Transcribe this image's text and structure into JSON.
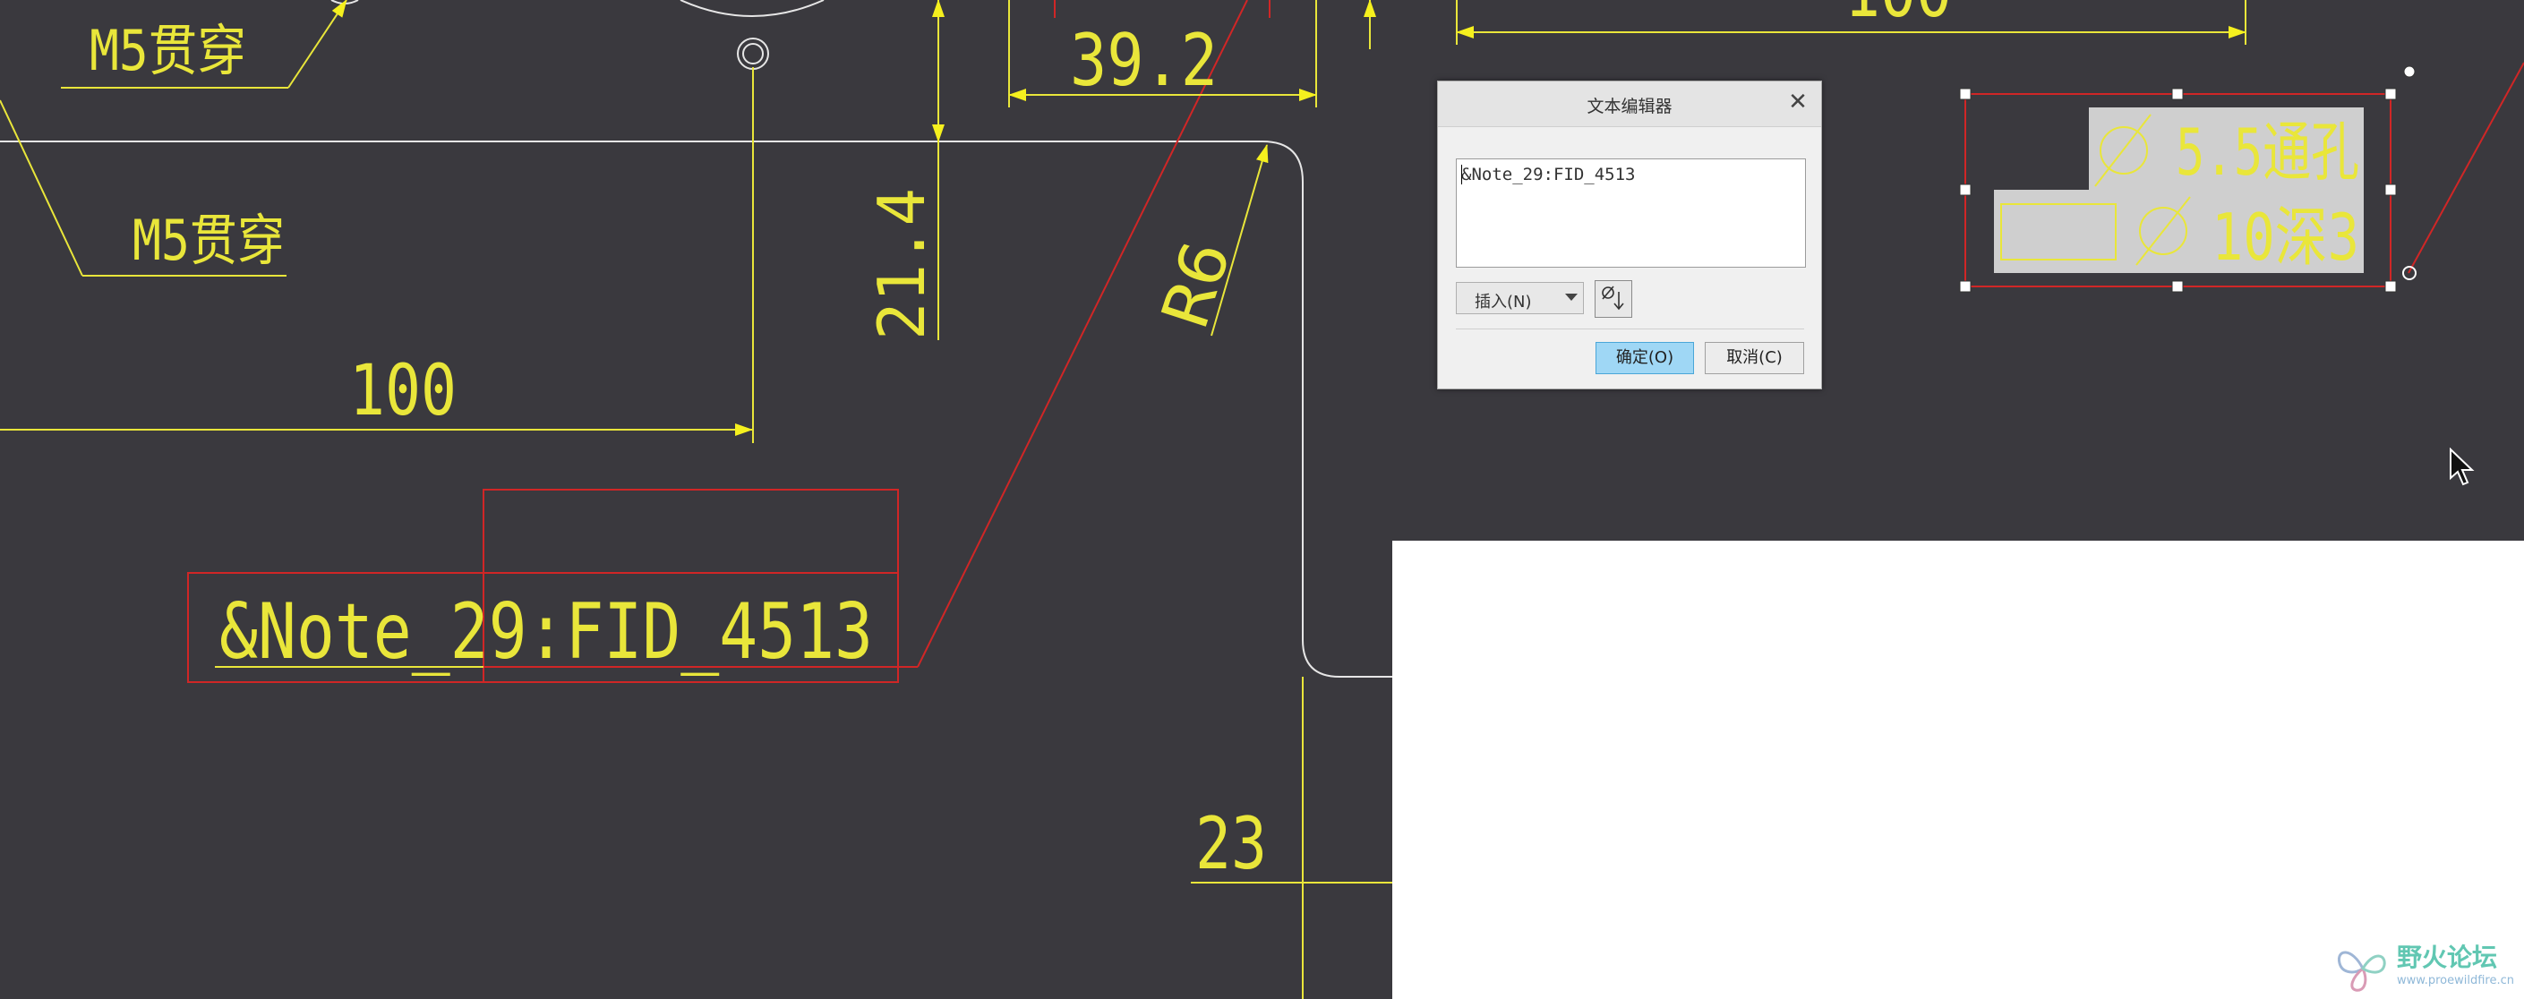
{
  "drawing": {
    "texts": {
      "m5_top": "M5贯穿",
      "m5_mid": "M5贯穿",
      "dim_100_left": "100",
      "dim_100_top": "100",
      "dim_39_2": "39.2",
      "dim_21_4": "21.4",
      "dim_r6": "R6",
      "dim_23": "23",
      "note_placeholder": "&Note_29:FID_4513",
      "hole_diameter": "5.5通孔",
      "cbore_diameter": "10深3"
    },
    "colors": {
      "background": "#3a393e",
      "dimension": "#e9e63a",
      "selection": "#d02626",
      "geometry": "#e6e6e6",
      "highlight_box": "#cfcfcf"
    }
  },
  "dialog": {
    "title": "文本编辑器",
    "close_icon": "close-icon",
    "text_value": "&Note_29:FID_4513",
    "insert_label": "插入(N)",
    "symbol_icon": "diameter-symbol-icon",
    "ok_label": "确定(O)",
    "cancel_label": "取消(C)"
  },
  "watermark": {
    "name": "野火论坛",
    "url": "www.proewildfire.cn",
    "logo_icon": "butterfly-logo-icon"
  }
}
